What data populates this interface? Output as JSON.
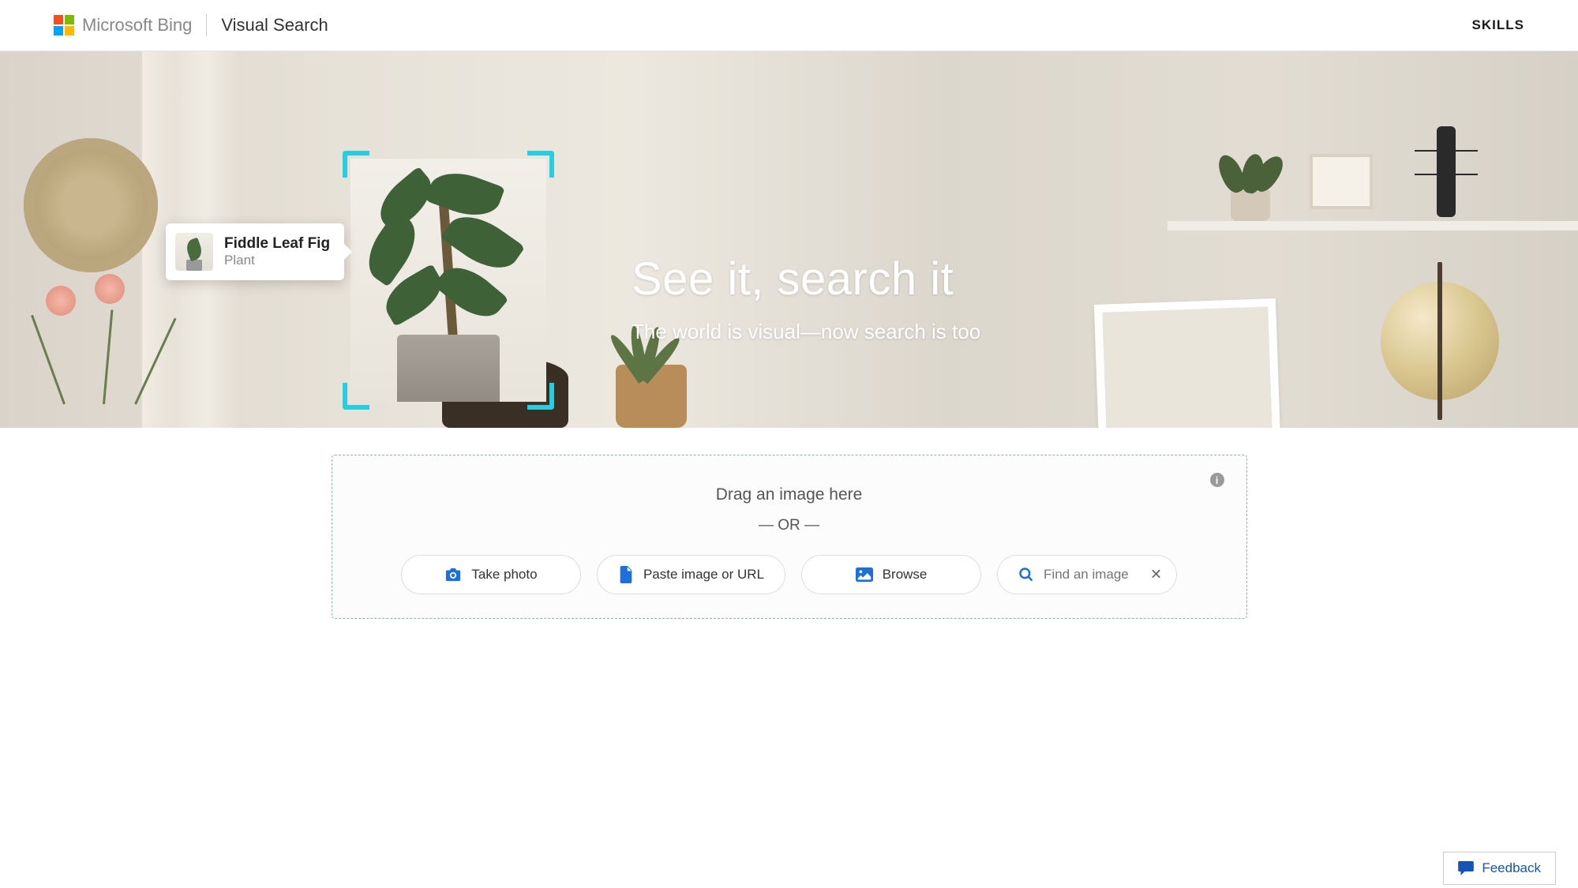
{
  "header": {
    "brand": "Microsoft Bing",
    "product": "Visual Search",
    "skills": "SKILLS"
  },
  "tooltip": {
    "title": "Fiddle Leaf Fig",
    "subtitle": "Plant"
  },
  "hero": {
    "headline": "See it, search it",
    "subtitle": "The world is visual—now search is too"
  },
  "upload": {
    "drag_text": "Drag an image here",
    "or_text": "— OR —",
    "take_photo": "Take photo",
    "paste": "Paste image or URL",
    "browse": "Browse",
    "find_placeholder": "Find an image"
  },
  "feedback": "Feedback"
}
